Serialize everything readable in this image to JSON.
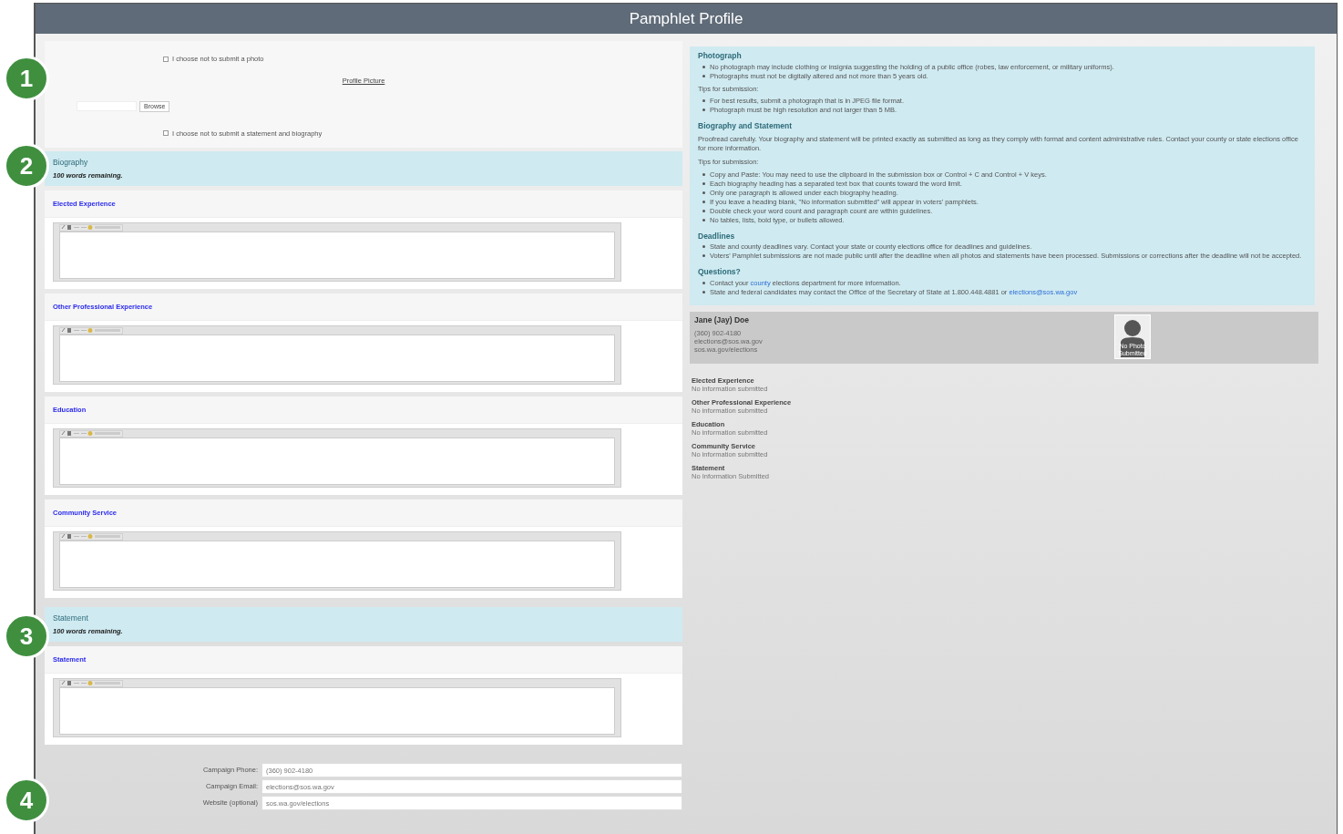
{
  "title": "Pamphlet Profile",
  "photo_options": {
    "no_photo": {
      "label": "I choose not to submit a photo",
      "checked": false
    },
    "profile_picture_link": "Profile Picture",
    "browse_button": "Browse",
    "no_statement": {
      "label": "I choose not to submit a statement and biography",
      "checked": false
    }
  },
  "biography": {
    "title": "Biography",
    "words_remaining": "100 words remaining.",
    "sections": [
      {
        "heading": "Elected Experience"
      },
      {
        "heading": "Other Professional Experience"
      },
      {
        "heading": "Education"
      },
      {
        "heading": "Community Service"
      }
    ]
  },
  "statement": {
    "title": "Statement",
    "words_remaining": "100 words remaining.",
    "sections": [
      {
        "heading": "Statement"
      }
    ]
  },
  "contact_fields": [
    {
      "label": "Campaign Phone:",
      "value": "(360) 902-4180"
    },
    {
      "label": "Campaign Email:",
      "value": "elections@sos.wa.gov"
    },
    {
      "label": "Website (optional)",
      "value": "sos.wa.gov/elections"
    }
  ],
  "guidelines": [
    {
      "heading": "Photograph",
      "blocks": [
        {
          "kind": "list",
          "items": [
            [
              {
                "text": "No photograph may include clothing or insignia suggesting the holding of a public office (robes, law enforcement, or military uniforms).",
                "link": false
              }
            ],
            [
              {
                "text": "Photographs must not be digitally altered and not more than 5 years old.",
                "link": false
              }
            ]
          ]
        },
        {
          "kind": "para",
          "text": "Tips for submission:"
        },
        {
          "kind": "list",
          "items": [
            [
              {
                "text": "For best results, submit a photograph that is in JPEG file format.",
                "link": false
              }
            ],
            [
              {
                "text": "Photograph must be high resolution and not larger than 5 MB.",
                "link": false
              }
            ]
          ]
        }
      ]
    },
    {
      "heading": "Biography and Statement",
      "blocks": [
        {
          "kind": "para",
          "text": "Proofread carefully. Your biography and statement will be printed exactly as submitted as long as they comply with format and content administrative rules. Contact your county or state elections office for more information."
        },
        {
          "kind": "para",
          "text": "Tips for submission:"
        },
        {
          "kind": "list",
          "items": [
            [
              {
                "text": "Copy and Paste: You may need to use the clipboard in the submission box or Control + C and Control + V keys.",
                "link": false
              }
            ],
            [
              {
                "text": "Each biography heading has a separated text box that counts toward the word limit.",
                "link": false
              }
            ],
            [
              {
                "text": "Only one paragraph is allowed under each biography heading.",
                "link": false
              }
            ],
            [
              {
                "text": "If you leave a heading blank, \"No information submitted\" will appear in voters' pamphlets.",
                "link": false
              }
            ],
            [
              {
                "text": "Double check your word count and paragraph count are within guidelines.",
                "link": false
              }
            ],
            [
              {
                "text": "No tables, lists, bold type, or bullets allowed.",
                "link": false
              }
            ]
          ]
        }
      ]
    },
    {
      "heading": "Deadlines",
      "blocks": [
        {
          "kind": "list",
          "items": [
            [
              {
                "text": "State and county deadlines vary. Contact your state or county elections office for deadlines and guidelines.",
                "link": false
              }
            ],
            [
              {
                "text": "Voters' Pamphlet submissions are not made public until after the deadline when all photos and statements have been processed. Submissions or corrections after the deadline will not be accepted.",
                "link": false
              }
            ]
          ]
        }
      ]
    },
    {
      "heading": "Questions?",
      "blocks": [
        {
          "kind": "list",
          "items": [
            [
              {
                "text": "Contact your "
              },
              {
                "text": "county",
                "link": true
              },
              {
                "text": " elections department for more information."
              }
            ],
            [
              {
                "text": "State and federal candidates may contact the Office of the Secretary of State at 1.800.448.4881 or "
              },
              {
                "text": "elections@sos.wa.gov",
                "link": true
              }
            ]
          ]
        }
      ]
    }
  ],
  "preview": {
    "name": "Jane (Jay) Doe",
    "contact_lines": [
      "(360) 902-4180",
      "elections@sos.wa.gov",
      "sos.wa.gov/elections"
    ],
    "photo_caption": "No Photo Submitted",
    "sections": [
      {
        "heading": "Elected Experience",
        "text": "No information submitted"
      },
      {
        "heading": "Other Professional Experience",
        "text": "No information submitted"
      },
      {
        "heading": "Education",
        "text": "No information submitted"
      },
      {
        "heading": "Community Service",
        "text": "No information submitted"
      },
      {
        "heading": "Statement",
        "text": "No Information Submitted"
      }
    ]
  },
  "callouts": [
    "1",
    "2",
    "3",
    "4"
  ]
}
